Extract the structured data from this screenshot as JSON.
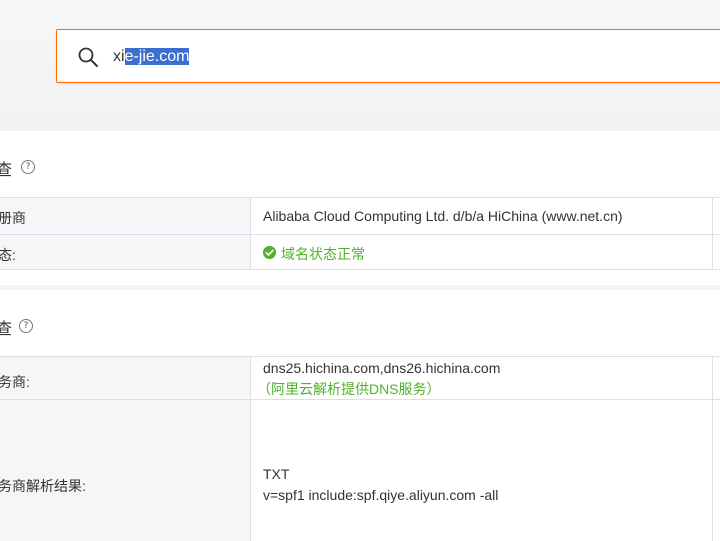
{
  "search": {
    "value_plain": "xi",
    "value_selected": "e-jie.com"
  },
  "registrar_section": {
    "title": "查",
    "help": "?",
    "rows": [
      {
        "label": "册商",
        "value": "Alibaba Cloud Computing Ltd. d/b/a HiChina (www.net.cn)"
      },
      {
        "label": "态:",
        "value": "域名状态正常"
      }
    ]
  },
  "dns_section": {
    "title": "查",
    "help": "?",
    "rows": [
      {
        "label": "务商:",
        "value_line1": "dns25.hichina.com,dns26.hichina.com",
        "value_line2": "（阿里云解析提供DNS服务）"
      },
      {
        "label": "务商解析结果:",
        "value_line1": "TXT",
        "value_line2": "v=spf1 include:spf.qiye.aliyun.com -all"
      }
    ]
  },
  "colors": {
    "accent": "#ff6a00",
    "success": "#52b12c",
    "selection": "#3a6fd0"
  },
  "icons": [
    "search-icon",
    "help-icon",
    "check-circle-icon"
  ]
}
